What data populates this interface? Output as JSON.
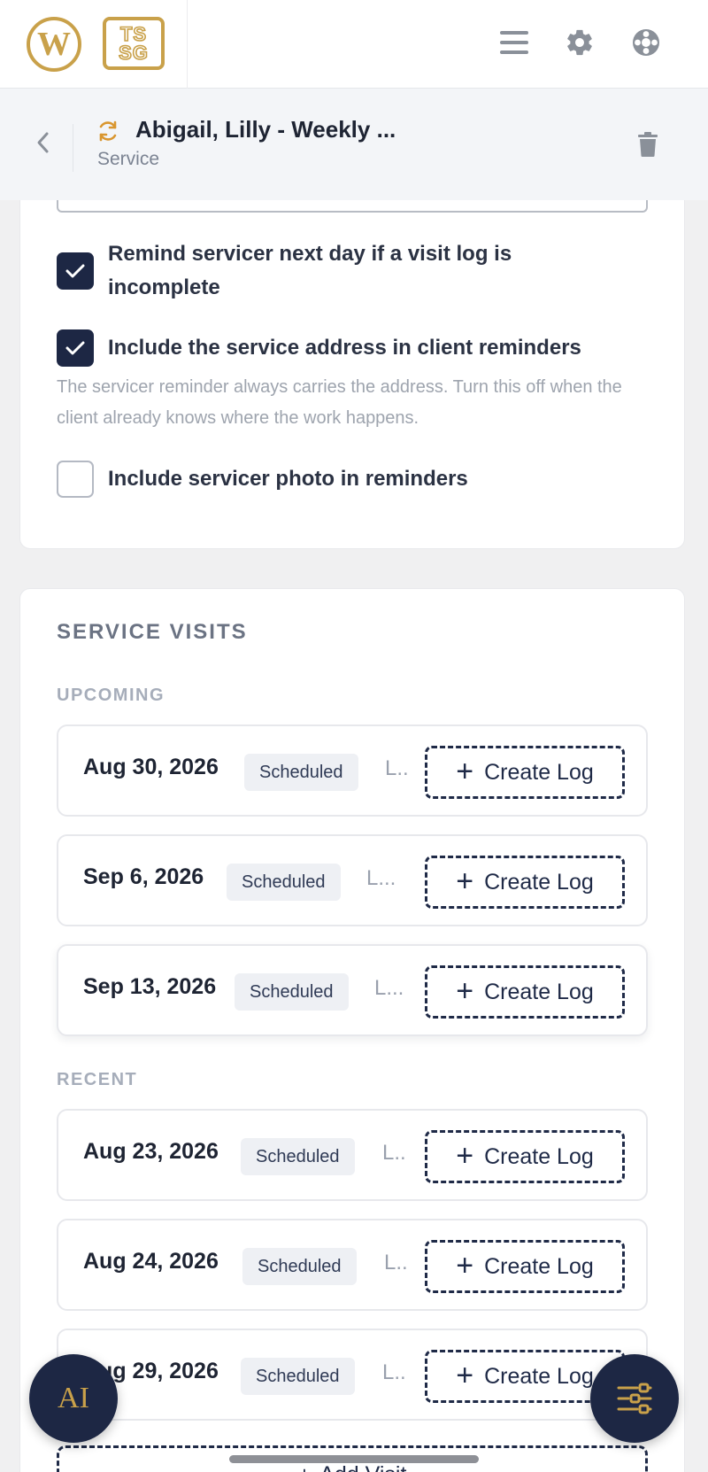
{
  "topbar": {
    "logo_wp": "W",
    "logo_tssg_line1": "TS",
    "logo_tssg_line2": "SG",
    "icons": [
      "menu-icon",
      "gear-icon",
      "support-icon"
    ]
  },
  "header": {
    "title": "Abigail, Lilly - Weekly ...",
    "subtitle": "Service",
    "icons": [
      "back-chevron-icon",
      "sync-icon",
      "trash-icon"
    ]
  },
  "reminders": {
    "options": [
      {
        "label": "Remind servicer next day if a visit log is incomplete",
        "checked": true
      },
      {
        "label": "Include the service address in client reminders",
        "checked": true
      },
      {
        "label": "Include servicer photo in reminders",
        "checked": false
      }
    ],
    "address_help": "The servicer reminder always carries the address. Turn this off when the client already knows where the work happens."
  },
  "visits": {
    "section_title": "SERVICE VISITS",
    "upcoming_label": "UPCOMING",
    "recent_label": "RECENT",
    "create_log_label": "Create Log",
    "add_visit_label": "Add Visit",
    "upcoming": [
      {
        "date": "Aug 30, 2026",
        "status": "Scheduled",
        "extra": "L.."
      },
      {
        "date": "Sep 6, 2026",
        "status": "Scheduled",
        "extra": "L..."
      },
      {
        "date": "Sep 13, 2026",
        "status": "Scheduled",
        "extra": "L..."
      }
    ],
    "recent": [
      {
        "date": "Aug 23, 2026",
        "status": "Scheduled",
        "extra": "L.."
      },
      {
        "date": "Aug 24, 2026",
        "status": "Scheduled",
        "extra": "L.."
      },
      {
        "date": "Aug 29, 2026",
        "status": "Scheduled",
        "extra": "L.."
      }
    ]
  },
  "fab": {
    "ai_label": "AI",
    "menu_icon": "filter-menu-icon"
  },
  "colors": {
    "navy": "#1d2744",
    "gold": "#c9a14a",
    "badge_bg": "#eef0f4"
  }
}
